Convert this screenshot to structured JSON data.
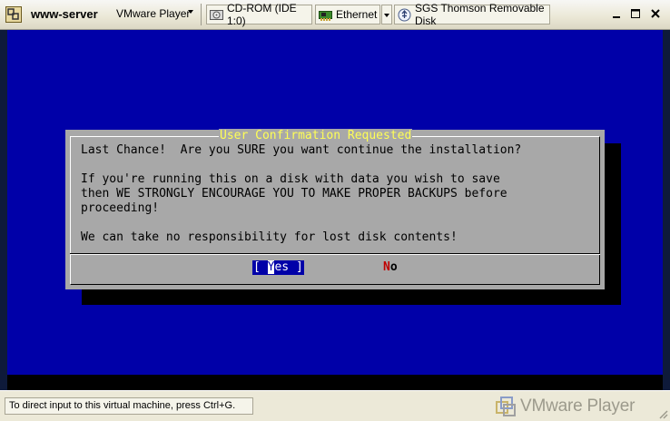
{
  "window": {
    "vm_name": "www-server",
    "player_menu_label": "VMware Player",
    "devices": [
      {
        "label": "CD-ROM (IDE 1:0)",
        "icon": "cdrom-icon"
      },
      {
        "label": "Ethernet",
        "icon": "network-adapter-icon"
      },
      {
        "label": "SGS Thomson Removable Disk",
        "icon": "usb-device-icon"
      }
    ],
    "controls": [
      "minimize",
      "maximize",
      "close"
    ]
  },
  "console": {
    "background_color": "#0000a8",
    "dialog": {
      "title": "User Confirmation Requested",
      "lines": [
        "Last Chance!  Are you SURE you want continue the installation?",
        "",
        "If you're running this on a disk with data you wish to save",
        "then WE STRONGLY ENCOURAGE YOU TO MAKE PROPER BACKUPS before",
        "proceeding!",
        "",
        "We can take no responsibility for lost disk contents!"
      ],
      "yes_button": {
        "prefix": "[ ",
        "hotkey": "Y",
        "rest": "es ]",
        "selected": true
      },
      "no_button": {
        "hotkey": "N",
        "rest": "o",
        "selected": false
      },
      "colors": {
        "title": "#ffff55",
        "body": "#a8a8a8",
        "selection": "#0000a8",
        "hotkey": "#c00000"
      }
    }
  },
  "statusbar": {
    "hint": "To direct input to this virtual machine, press Ctrl+G.",
    "brand": "VMware Player"
  }
}
